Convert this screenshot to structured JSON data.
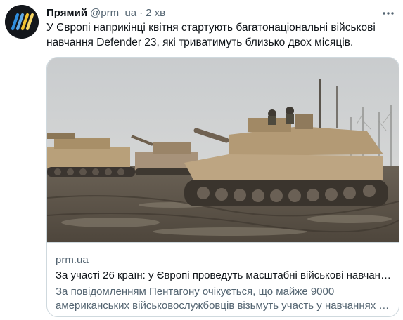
{
  "tweet": {
    "display_name": "Прямий",
    "handle": "@prm_ua",
    "separator": "·",
    "time": "2 хв",
    "text": "У Європі наприкінці квітня стартують багатонаціональні військові навчання Defender 23, які триватимуть близько двох місяців.",
    "more_icon": "more-horizontal-icon",
    "avatar_icon": "prm-logo-stripes"
  },
  "card": {
    "image_alt": "tanks-in-mud-photo",
    "domain": "prm.ua",
    "title": "За участі 26 країн: у Європі проведуть масштабні військові навчан…",
    "description": "За повідомленням Пентагону очікується, що майже 9000 американських військовослужбовців візьмуть участь у навчаннях …"
  },
  "colors": {
    "text_primary": "#0f1419",
    "text_secondary": "#536471",
    "border": "#cfd9de",
    "avatar_bg": "#14171c",
    "avatar_stripe_blue": "#2f8fe0",
    "avatar_stripe_yellow": "#f2c230"
  }
}
